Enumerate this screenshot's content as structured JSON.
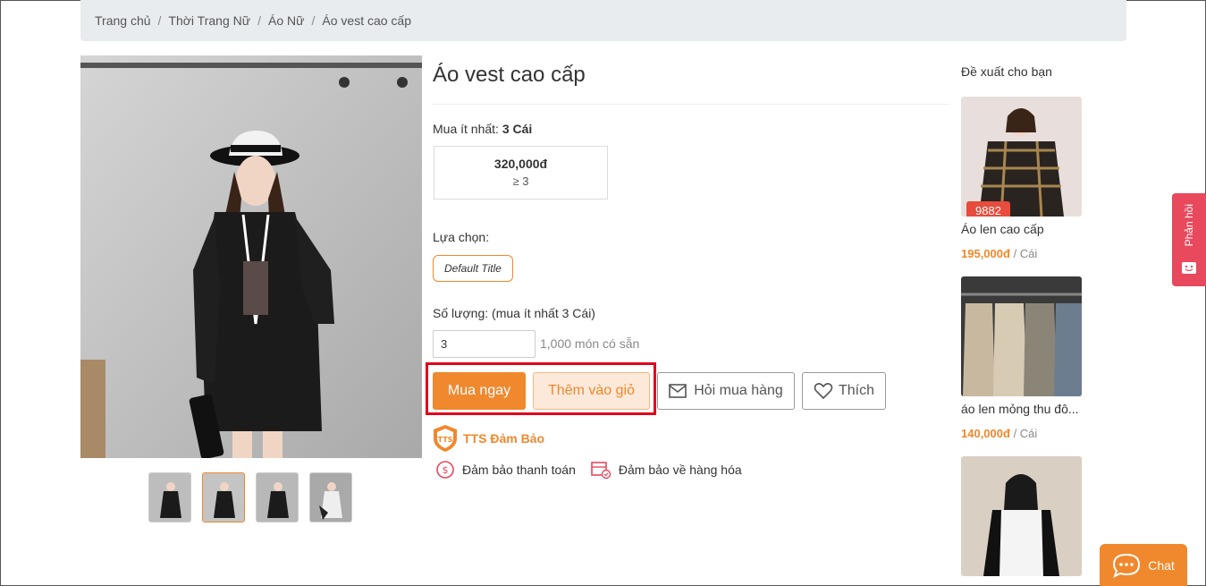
{
  "breadcrumb": {
    "items": [
      "Trang chủ",
      "Thời Trang Nữ",
      "Áo Nữ",
      "Áo vest cao cấp"
    ],
    "separator": "/"
  },
  "product": {
    "title": "Áo vest cao cấp",
    "min_buy_label": "Mua ít nhất:",
    "min_buy_value": "3 Cái",
    "price": "320,000đ",
    "price_condition": "≥ 3",
    "option_label": "Lựa chọn:",
    "option_value": "Default Title",
    "qty_label": "Số lượng: (mua ít nhất 3 Cái)",
    "qty_value": "3",
    "stock": "1,000 món có sẵn"
  },
  "actions": {
    "buy_now": "Mua ngay",
    "add_to_cart": "Thêm vào giỏ",
    "ask": "Hỏi mua hàng",
    "like": "Thích"
  },
  "guarantee": {
    "title": "TTS Đảm Bảo",
    "badge_text": "TTS",
    "payment": "Đảm bảo thanh toán",
    "goods": "Đảm bảo về hàng hóa"
  },
  "recommendations": {
    "title": "Đề xuất cho bạn",
    "items": [
      {
        "name": "Áo len cao cấp",
        "price": "195,000đ",
        "unit": "/ Cái",
        "badge": "9882"
      },
      {
        "name": "áo len mỏng thu đô...",
        "price": "140,000đ",
        "unit": "/ Cái"
      },
      {
        "name": "",
        "price": "",
        "unit": ""
      }
    ]
  },
  "feedback": {
    "label": "Phản hồi"
  },
  "chat": {
    "label": "Chat"
  },
  "colors": {
    "accent": "#f0882d",
    "highlight": "#e0001b",
    "feedback": "#e8495d"
  }
}
